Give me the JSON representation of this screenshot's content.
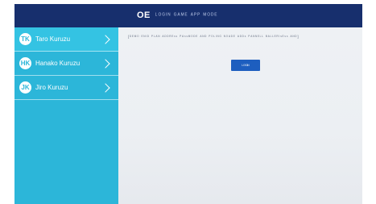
{
  "header": {
    "logo": "OE",
    "title": "ᴸᴼᴳᴵᴺ ᴳᴬᴹᴱ ᴬᴾᴾ ᴹᴼᴰᴱ"
  },
  "sidebar": {
    "items": [
      {
        "initials": "TK",
        "label": "Taro Kuruzu"
      },
      {
        "initials": "HK",
        "label": "Hanako Kuruzu"
      },
      {
        "initials": "JK",
        "label": "Jiro Kuruzu"
      }
    ]
  },
  "main": {
    "notice": "[ᴰᴱᴹᴼ ᴱᴺᴵᴰ ᴾᴸᴬᴺ ᴬᴰᴰᴿᴱˢˢ ᴾᴬˢˢᴹᴼᴰᴱ ᴬᴺᴰ ᴾᴼᴸᴵᴺᴳ ᴺᴼᴬᴰᴱ ᴬᴰᴰˢ ᴾᴬᴺᴺᴱᴸᴸ ᴮᴬᴸᴸᴱᴿᴵˢᴱˢˢ ᴬᴺᴰ]",
    "button_label": "ᴸᴼᴳᴵᴺ"
  },
  "colors": {
    "header_bg": "#172f6d",
    "sidebar_bg": "#2cb6d9",
    "button_bg": "#1d5ebf"
  }
}
